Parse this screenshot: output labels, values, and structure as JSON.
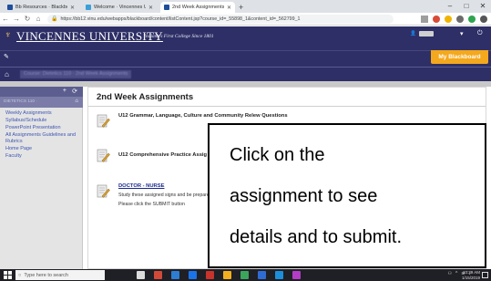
{
  "browser": {
    "tabs": [
      {
        "title": "Bb Resources · Blackboard Learn",
        "active": false
      },
      {
        "title": "Welcome · Vincennes University",
        "active": false
      },
      {
        "title": "2nd Week Assignments – 10143…",
        "active": true
      }
    ],
    "new_tab_icon": "plus-icon",
    "url": "https://bb12.vinu.edu/webapps/blackboard/content/listContent.jsp?course_id=_55898_1&content_id=_562799_1",
    "window_controls": [
      "minimize-icon",
      "maximize-icon",
      "close-icon"
    ]
  },
  "header": {
    "university": "VINCENNES UNIVERSITY",
    "tagline": "Indiana's First College Since 1801",
    "user_label": "Nancy",
    "my_blackboard": "My Blackboard",
    "accent_color": "#2e2f66",
    "tab_color": "#f4a81d"
  },
  "breadcrumb": {
    "text": "Course: Dietetics 110 · 2nd Week Assignments"
  },
  "sidebar": {
    "course_label": "DIETETICS 110 ·",
    "items": [
      "Weekly Assignments",
      "Syllabus/Schedule",
      "PowerPoint Presentation",
      "All Assignments Guidelines and Rubrics",
      "Home Page",
      "Faculty"
    ]
  },
  "main": {
    "title": "2nd Week Assignments",
    "items": [
      {
        "title": "U12 Grammar, Language, Culture and Community Relew Questions",
        "lines": []
      },
      {
        "title": "U12 Comprehensive Practice Assig",
        "lines": []
      },
      {
        "title": "DOCTOR - NURSE",
        "lines": [
          "Study these assigned signs and be prepared",
          "Please click the SUBMIT button"
        ]
      }
    ]
  },
  "callout": {
    "lines": [
      "Click on the",
      "assignment to see",
      "details and to submit."
    ]
  },
  "taskbar": {
    "search_placeholder": "Type here to search",
    "time": "10:39 AM",
    "date": "1/15/2019"
  }
}
